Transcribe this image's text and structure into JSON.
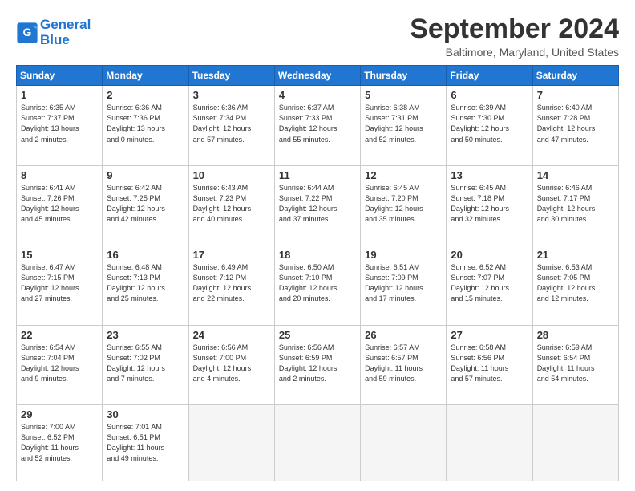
{
  "header": {
    "logo_line1": "General",
    "logo_line2": "Blue",
    "month": "September 2024",
    "location": "Baltimore, Maryland, United States"
  },
  "weekdays": [
    "Sunday",
    "Monday",
    "Tuesday",
    "Wednesday",
    "Thursday",
    "Friday",
    "Saturday"
  ],
  "days": [
    {
      "num": "",
      "info": ""
    },
    {
      "num": "",
      "info": ""
    },
    {
      "num": "",
      "info": ""
    },
    {
      "num": "1",
      "info": "Sunrise: 6:35 AM\nSunset: 7:37 PM\nDaylight: 13 hours\nand 2 minutes."
    },
    {
      "num": "",
      "info": ""
    },
    {
      "num": "",
      "info": ""
    },
    {
      "num": "",
      "info": ""
    },
    {
      "num": "2",
      "info": "Sunrise: 6:36 AM\nSunset: 7:36 PM\nDaylight: 13 hours\nand 0 minutes."
    },
    {
      "num": "3",
      "info": "Sunrise: 6:36 AM\nSunset: 7:34 PM\nDaylight: 12 hours\nand 57 minutes."
    },
    {
      "num": "4",
      "info": "Sunrise: 6:37 AM\nSunset: 7:33 PM\nDaylight: 12 hours\nand 55 minutes."
    },
    {
      "num": "5",
      "info": "Sunrise: 6:38 AM\nSunset: 7:31 PM\nDaylight: 12 hours\nand 52 minutes."
    },
    {
      "num": "6",
      "info": "Sunrise: 6:39 AM\nSunset: 7:30 PM\nDaylight: 12 hours\nand 50 minutes."
    },
    {
      "num": "7",
      "info": "Sunrise: 6:40 AM\nSunset: 7:28 PM\nDaylight: 12 hours\nand 47 minutes."
    },
    {
      "num": "8",
      "info": "Sunrise: 6:41 AM\nSunset: 7:26 PM\nDaylight: 12 hours\nand 45 minutes."
    },
    {
      "num": "9",
      "info": "Sunrise: 6:42 AM\nSunset: 7:25 PM\nDaylight: 12 hours\nand 42 minutes."
    },
    {
      "num": "10",
      "info": "Sunrise: 6:43 AM\nSunset: 7:23 PM\nDaylight: 12 hours\nand 40 minutes."
    },
    {
      "num": "11",
      "info": "Sunrise: 6:44 AM\nSunset: 7:22 PM\nDaylight: 12 hours\nand 37 minutes."
    },
    {
      "num": "12",
      "info": "Sunrise: 6:45 AM\nSunset: 7:20 PM\nDaylight: 12 hours\nand 35 minutes."
    },
    {
      "num": "13",
      "info": "Sunrise: 6:45 AM\nSunset: 7:18 PM\nDaylight: 12 hours\nand 32 minutes."
    },
    {
      "num": "14",
      "info": "Sunrise: 6:46 AM\nSunset: 7:17 PM\nDaylight: 12 hours\nand 30 minutes."
    },
    {
      "num": "15",
      "info": "Sunrise: 6:47 AM\nSunset: 7:15 PM\nDaylight: 12 hours\nand 27 minutes."
    },
    {
      "num": "16",
      "info": "Sunrise: 6:48 AM\nSunset: 7:13 PM\nDaylight: 12 hours\nand 25 minutes."
    },
    {
      "num": "17",
      "info": "Sunrise: 6:49 AM\nSunset: 7:12 PM\nDaylight: 12 hours\nand 22 minutes."
    },
    {
      "num": "18",
      "info": "Sunrise: 6:50 AM\nSunset: 7:10 PM\nDaylight: 12 hours\nand 20 minutes."
    },
    {
      "num": "19",
      "info": "Sunrise: 6:51 AM\nSunset: 7:09 PM\nDaylight: 12 hours\nand 17 minutes."
    },
    {
      "num": "20",
      "info": "Sunrise: 6:52 AM\nSunset: 7:07 PM\nDaylight: 12 hours\nand 15 minutes."
    },
    {
      "num": "21",
      "info": "Sunrise: 6:53 AM\nSunset: 7:05 PM\nDaylight: 12 hours\nand 12 minutes."
    },
    {
      "num": "22",
      "info": "Sunrise: 6:54 AM\nSunset: 7:04 PM\nDaylight: 12 hours\nand 9 minutes."
    },
    {
      "num": "23",
      "info": "Sunrise: 6:55 AM\nSunset: 7:02 PM\nDaylight: 12 hours\nand 7 minutes."
    },
    {
      "num": "24",
      "info": "Sunrise: 6:56 AM\nSunset: 7:00 PM\nDaylight: 12 hours\nand 4 minutes."
    },
    {
      "num": "25",
      "info": "Sunrise: 6:56 AM\nSunset: 6:59 PM\nDaylight: 12 hours\nand 2 minutes."
    },
    {
      "num": "26",
      "info": "Sunrise: 6:57 AM\nSunset: 6:57 PM\nDaylight: 11 hours\nand 59 minutes."
    },
    {
      "num": "27",
      "info": "Sunrise: 6:58 AM\nSunset: 6:56 PM\nDaylight: 11 hours\nand 57 minutes."
    },
    {
      "num": "28",
      "info": "Sunrise: 6:59 AM\nSunset: 6:54 PM\nDaylight: 11 hours\nand 54 minutes."
    },
    {
      "num": "29",
      "info": "Sunrise: 7:00 AM\nSunset: 6:52 PM\nDaylight: 11 hours\nand 52 minutes."
    },
    {
      "num": "30",
      "info": "Sunrise: 7:01 AM\nSunset: 6:51 PM\nDaylight: 11 hours\nand 49 minutes."
    },
    {
      "num": "",
      "info": ""
    },
    {
      "num": "",
      "info": ""
    },
    {
      "num": "",
      "info": ""
    },
    {
      "num": "",
      "info": ""
    },
    {
      "num": "",
      "info": ""
    }
  ]
}
